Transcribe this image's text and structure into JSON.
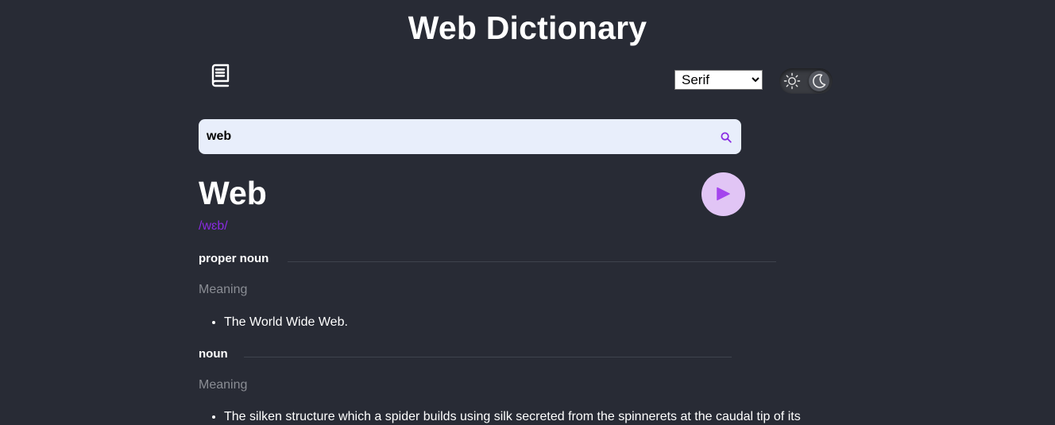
{
  "header": {
    "title": "Web Dictionary"
  },
  "toolbar": {
    "logo_icon": "book-icon",
    "font_select": {
      "selected": "Serif",
      "options": [
        "Serif"
      ]
    },
    "theme_toggle": {
      "sun_icon": "sun-icon",
      "moon_icon": "moon-icon",
      "mode": "dark"
    }
  },
  "search": {
    "value": "web",
    "icon": "search-icon"
  },
  "entry": {
    "word": "Web",
    "phonetic": "/wɛb/",
    "play_icon": "play-icon",
    "meanings": [
      {
        "part_of_speech": "proper noun",
        "label": "Meaning",
        "definitions": [
          "The World Wide Web."
        ]
      },
      {
        "part_of_speech": "noun",
        "label": "Meaning",
        "definitions": [
          "The silken structure which a spider builds using silk secreted from the spinnerets at the caudal tip of its"
        ]
      }
    ]
  },
  "colors": {
    "background": "#282b35",
    "accent": "#8a2be2",
    "search_bg": "#e8eefb",
    "play_bg": "#e1c5f5",
    "muted_text": "#8a8d94"
  }
}
